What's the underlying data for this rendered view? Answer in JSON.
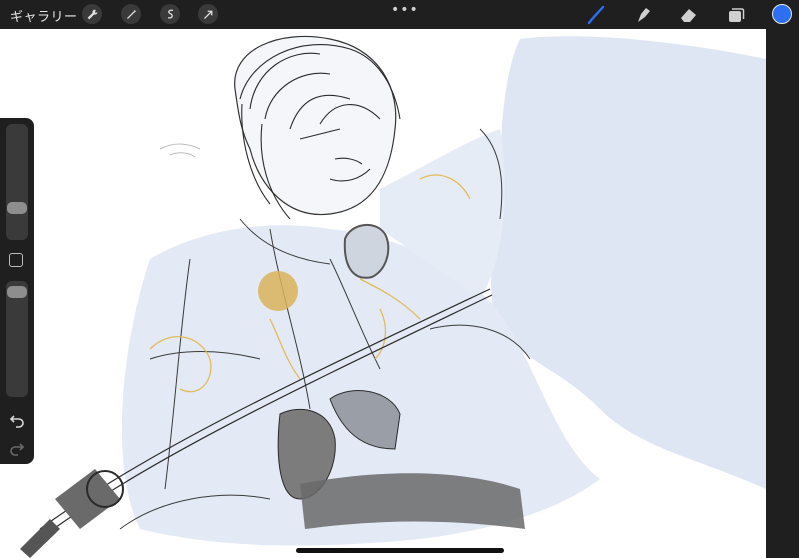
{
  "toolbar": {
    "gallery_label": "ギャラリー",
    "more_label": "•••"
  },
  "tools_left": [
    "wrench-icon",
    "magic-wand-icon",
    "selection-icon",
    "transform-arrow-icon"
  ],
  "tools_right": [
    "brush-icon",
    "smudge-icon",
    "eraser-icon",
    "layers-icon"
  ],
  "colors": {
    "toolbar_bg": "#1f1f1f",
    "active_tool": "#2d6ff2",
    "current_color": "#2d6ff2"
  },
  "sidebar": {
    "brush_size": 0.25,
    "brush_opacity": 0.95
  }
}
